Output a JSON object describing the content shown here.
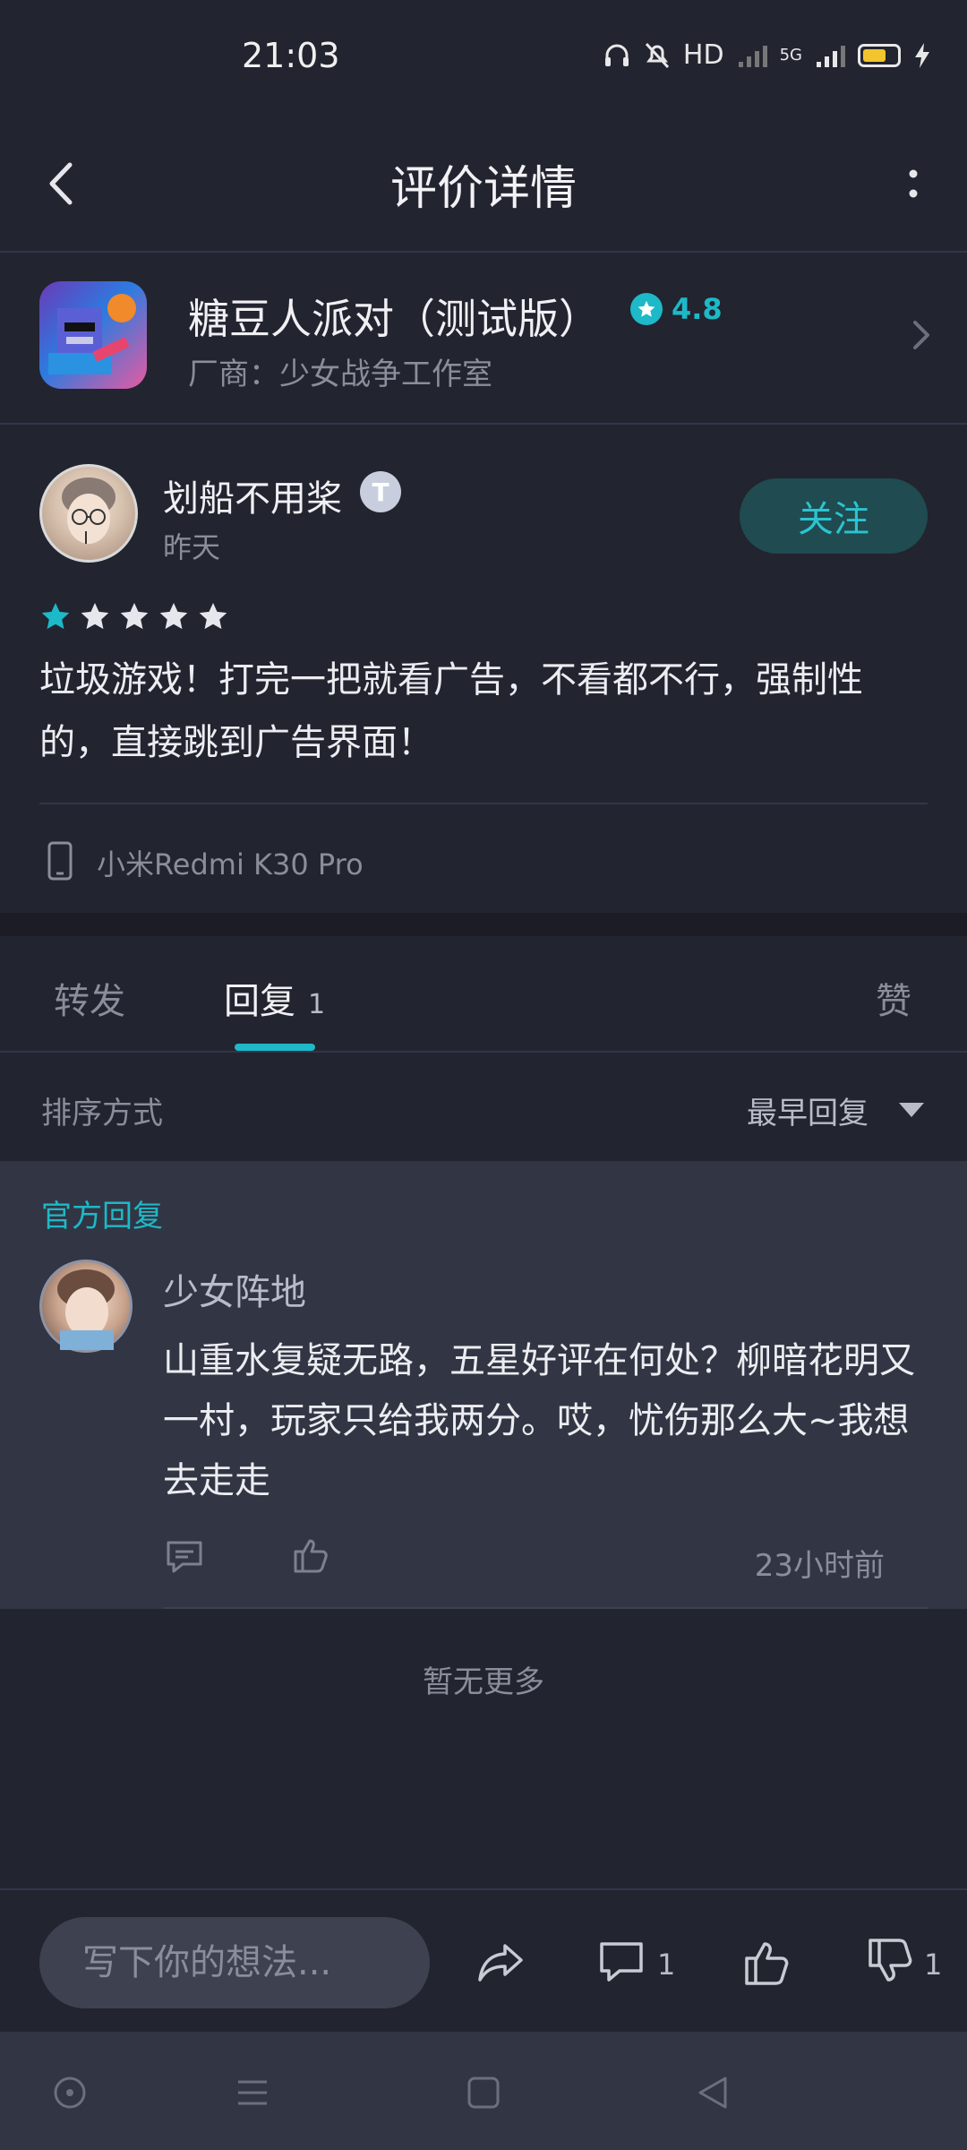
{
  "status_bar": {
    "time": "21:03",
    "network": "HD",
    "cellular": "5G"
  },
  "navbar": {
    "title": "评价详情"
  },
  "app": {
    "name": "糖豆人派对（测试版）",
    "rating": "4.8",
    "vendor": "厂商：少女战争工作室"
  },
  "review": {
    "user_name": "划船不用桨",
    "badge": "T",
    "time": "昨天",
    "follow_label": "关注",
    "stars_filled": 1,
    "stars_total": 5,
    "text": "垃圾游戏！打完一把就看广告，不看都不行，强制性的，直接跳到广告界面！",
    "device": "小米Redmi K30 Pro"
  },
  "tabs": {
    "forward": "转发",
    "reply": "回复",
    "reply_count": "1",
    "like": "赞"
  },
  "sort": {
    "label": "排序方式",
    "value": "最早回复"
  },
  "official_reply": {
    "label": "官方回复",
    "name": "少女阵地",
    "text": "山重水复疑无路，五星好评在何处？柳暗花明又一村，玩家只给我两分。哎，忧伤那么大~我想去走走",
    "time": "23小时前"
  },
  "no_more": "暂无更多",
  "bottom_bar": {
    "input_placeholder": "写下你的想法...",
    "comment_count": "1",
    "dislike_count": "1"
  },
  "colors": {
    "accent": "#1db9c8",
    "background": "#22242f",
    "card": "#323644"
  }
}
